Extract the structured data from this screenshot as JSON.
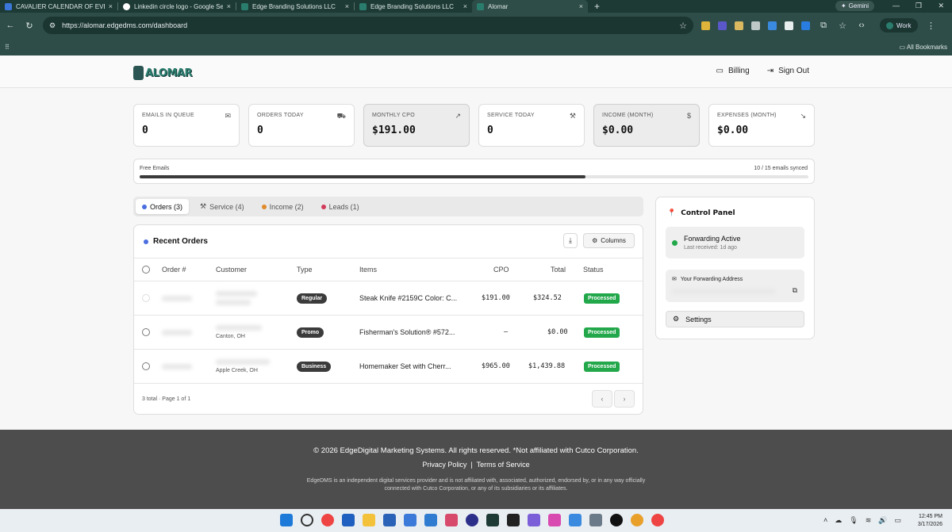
{
  "browser": {
    "tabs": [
      {
        "title": "CAVALIER CALENDAR OF EVENTS",
        "color": "#3b77d8"
      },
      {
        "title": "Linkedin circle logo - Google Se",
        "color": "#ffffff"
      },
      {
        "title": "Edge Branding Solutions LLC",
        "color": "#2a7d6d"
      },
      {
        "title": "Edge Branding Solutions LLC",
        "color": "#2a7d6d"
      },
      {
        "title": "Alomar",
        "color": "#2a7d6d"
      }
    ],
    "new_tab": "+",
    "gemini": "Gemini",
    "url": "https://alomar.edgedms.com/dashboard",
    "profile": "Work",
    "bookmarks": "All Bookmarks"
  },
  "header": {
    "logo": "ALOMAR",
    "billing": "Billing",
    "sign_out": "Sign Out"
  },
  "stats": [
    {
      "label": "EMAILS IN QUEUE",
      "value": "0",
      "icon": "mail-icon",
      "glyph": "✉"
    },
    {
      "label": "ORDERS TODAY",
      "value": "0",
      "icon": "cart-icon",
      "glyph": "🛒"
    },
    {
      "label": "MONTHLY CPO",
      "value": "$191.00",
      "icon": "trend-up-icon",
      "glyph": "↗"
    },
    {
      "label": "SERVICE TODAY",
      "value": "0",
      "icon": "wrench-icon",
      "glyph": "🔧"
    },
    {
      "label": "INCOME (MONTH)",
      "value": "$0.00",
      "icon": "dollar-icon",
      "glyph": "$"
    },
    {
      "label": "EXPENSES (MONTH)",
      "value": "$0.00",
      "icon": "trend-down-icon",
      "glyph": "↘"
    }
  ],
  "free_emails": {
    "label": "Free Emails",
    "synced": "10 / 15 emails synced",
    "fraction": 0.667
  },
  "tabs": [
    {
      "label": "Orders (3)",
      "color": "#4a6ee0"
    },
    {
      "label": "Service (4)",
      "color": "#999999"
    },
    {
      "label": "Income (2)",
      "color": "#e08a2a"
    },
    {
      "label": "Leads (1)",
      "color": "#d23a5a"
    }
  ],
  "orders": {
    "title": "Recent Orders",
    "columns_button": "Columns",
    "headers": {
      "order": "Order #",
      "customer": "Customer",
      "type": "Type",
      "items": "Items",
      "cpo": "CPO",
      "total": "Total",
      "status": "Status"
    },
    "rows": [
      {
        "location": "",
        "type": "Regular",
        "items": "Steak Knife #2159C Color: C...",
        "cpo": "$191.00",
        "total": "$324.52",
        "status": "Processed"
      },
      {
        "location": "Canton, OH",
        "type": "Promo",
        "items": "Fisherman's Solution® #572...",
        "cpo": "–",
        "total": "$0.00",
        "status": "Processed"
      },
      {
        "location": "Apple Creek, OH",
        "type": "Business",
        "items": "Homemaker Set with Cherr...",
        "cpo": "$965.00",
        "total": "$1,439.88",
        "status": "Processed"
      }
    ],
    "footer": "3 total · Page 1 of 1"
  },
  "control_panel": {
    "title": "Control Panel",
    "forwarding_status": "Forwarding Active",
    "last_received": "Last received: 1d ago",
    "address_label": "Your Forwarding Address",
    "settings": "Settings"
  },
  "footer": {
    "copyright": "© 2026 EdgeDigital Marketing Systems. All rights reserved. *Not affiliated with Cutco Corporation.",
    "privacy": "Privacy Policy",
    "sep": "|",
    "terms": "Terms of Service",
    "disclaimer": "EdgeDMS is an independent digital services provider and is not affiliated with, associated, authorized, endorsed by, or in any way officially connected with Cutco Corporation, or any of its subsidiaries or its affiliates."
  },
  "taskbar": {
    "time": "12:45 PM",
    "date": "3/17/2026"
  }
}
